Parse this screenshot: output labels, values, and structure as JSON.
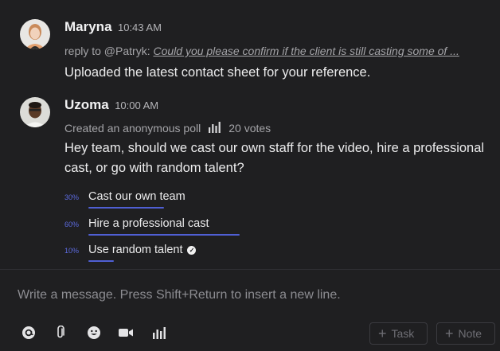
{
  "messages": [
    {
      "author": "Maryna",
      "time": "10:43 AM",
      "reply_prefix": "reply to @Patryk:",
      "reply_excerpt": "Could you please confirm if the client is still casting some of ...",
      "text": "Uploaded the latest contact sheet for your reference."
    },
    {
      "author": "Uzoma",
      "time": "10:00 AM",
      "poll_meta": "Created an anonymous poll",
      "votes": "20 votes",
      "question": "Hey team, should we cast our own staff for the video, hire a professional cast, or go with random talent?"
    }
  ],
  "poll": {
    "options": [
      {
        "percent_label": "30%",
        "label": "Cast our own team",
        "fraction": 0.3,
        "selected": false
      },
      {
        "percent_label": "60%",
        "label": "Hire a professional cast",
        "fraction": 0.6,
        "selected": false
      },
      {
        "percent_label": "10%",
        "label": "Use random talent",
        "fraction": 0.1,
        "selected": true
      }
    ]
  },
  "composer": {
    "placeholder": "Write a message. Press Shift+Return to insert a new line."
  },
  "toolbar": {
    "icons": [
      "mention-icon",
      "attachment-icon",
      "emoji-icon",
      "video-icon",
      "poll-icon"
    ],
    "task_label": "Task",
    "note_label": "Note"
  },
  "colors": {
    "background": "#1f1f21",
    "accent": "#4f5fd4"
  }
}
